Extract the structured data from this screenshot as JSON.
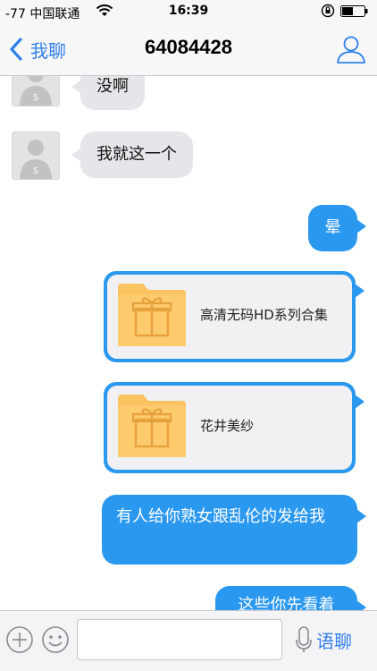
{
  "status_bar": {
    "signal_text": "-77 中国联通",
    "time": "16:39"
  },
  "nav": {
    "back_label": "我聊",
    "title": "64084428"
  },
  "messages": [
    {
      "side": "in",
      "text": "没啊"
    },
    {
      "side": "in",
      "text": "我就这一个"
    },
    {
      "side": "out",
      "text": "晕"
    },
    {
      "side": "out",
      "type": "file",
      "file_name": "高清无码HD系列合集"
    },
    {
      "side": "out",
      "type": "file",
      "file_name": "花井美纱"
    },
    {
      "side": "out",
      "text": "有人给你熟女跟乱伦的发给我"
    },
    {
      "side": "out",
      "text": "这些你先看着"
    }
  ],
  "input_bar": {
    "placeholder": "",
    "voice_label": "语聊"
  },
  "colors": {
    "accent": "#2f7fe9",
    "out_bubble": "#2b98f0",
    "in_bubble": "#e6e6ea",
    "folder": "#fcc461"
  }
}
